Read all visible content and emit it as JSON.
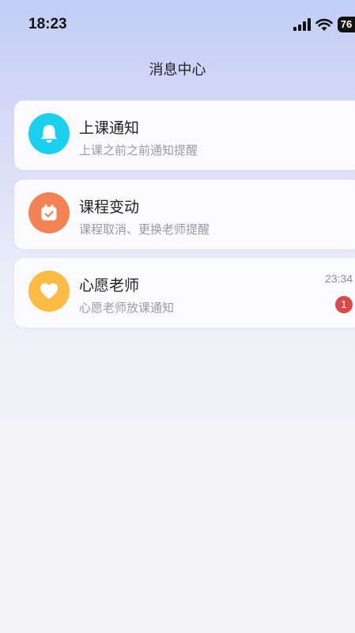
{
  "status_bar": {
    "time": "18:23",
    "battery": "76"
  },
  "header": {
    "title": "消息中心"
  },
  "messages": [
    {
      "title": "上课通知",
      "subtitle": "上课之前之前通知提醒",
      "icon": "bell-icon",
      "color": "#1bd0ef"
    },
    {
      "title": "课程变动",
      "subtitle": "课程取消、更换老师提醒",
      "icon": "calendar-check-icon",
      "color": "#f38355"
    },
    {
      "title": "心愿老师",
      "subtitle": "心愿老师放课通知",
      "icon": "heart-icon",
      "color": "#fbbb45",
      "time": "23:34",
      "unread": "1"
    }
  ]
}
